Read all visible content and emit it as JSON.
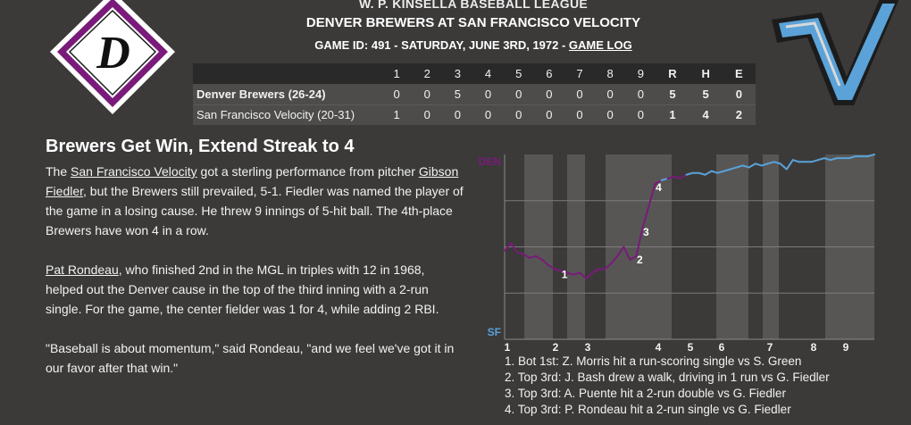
{
  "header": {
    "league": "W. P. KINSELLA BASEBALL LEAGUE",
    "matchup": "DENVER BREWERS AT SAN FRANCISCO VELOCITY",
    "game_info": "GAME ID: 491 - SATURDAY, JUNE 3RD, 1972 - ",
    "game_log_link": "GAME LOG"
  },
  "logos": {
    "home_logo_letter": "D",
    "home_logo_colors": {
      "outer": "#7a1a7a",
      "inner": "#ffffff",
      "letter": "#111111"
    },
    "away_logo_letter": "V",
    "away_logo_colors": {
      "fill": "#5aa2d8",
      "outline": "#1c1c1c"
    }
  },
  "linescore": {
    "innings": [
      "1",
      "2",
      "3",
      "4",
      "5",
      "6",
      "7",
      "8",
      "9"
    ],
    "totals_headers": [
      "R",
      "H",
      "E"
    ],
    "rows": [
      {
        "team": "Denver Brewers (26-24)",
        "innings": [
          "0",
          "0",
          "5",
          "0",
          "0",
          "0",
          "0",
          "0",
          "0"
        ],
        "totals": [
          "5",
          "5",
          "0"
        ]
      },
      {
        "team": "San Francisco Velocity (20-31)",
        "innings": [
          "1",
          "0",
          "0",
          "0",
          "0",
          "0",
          "0",
          "0",
          "0"
        ],
        "totals": [
          "1",
          "4",
          "2"
        ]
      }
    ]
  },
  "article": {
    "headline": "Brewers Get Win, Extend Streak to 4",
    "p1_a": "The ",
    "p1_link1": "San Francisco Velocity",
    "p1_b": " got a sterling performance from pitcher ",
    "p1_link2": "Gibson Fiedler",
    "p1_c": ", but the Brewers still prevailed, 5-1. Fiedler was named the player of the game in a losing cause. He threw 9 innings of 5-hit ball. The 4th-place Brewers have won 4 in a row.",
    "p2_link": "Pat Rondeau",
    "p2_text": ", who finished 2nd in the MGL in triples with 12 in 1968, helped out the Denver cause in the top of the third inning with a 2-run single. For the game, the center fielder was 1 for 4, while adding 2 RBI.",
    "p3": "\"Baseball is about momentum,\" said Rondeau, \"and we feel we've got it in our favor after that win.\""
  },
  "chart_data": {
    "type": "line",
    "top_label": "DEN",
    "bottom_label": "SF",
    "x_labels": [
      "1",
      "2",
      "3",
      "4",
      "5",
      "6",
      "7",
      "8",
      "9"
    ],
    "ylim": [
      0,
      1
    ],
    "colors": {
      "den": "#7a1a7a",
      "sf": "#5aa2d8",
      "label_den": "#7a1a7a",
      "label_sf": "#5aa2d8"
    },
    "series": [
      {
        "values": [
          0.48,
          0.52,
          0.47,
          0.46,
          0.44,
          0.45,
          0.43,
          0.4,
          0.38,
          0.37,
          0.36,
          0.35,
          0.36,
          0.33,
          0.36,
          0.38,
          0.38,
          0.41,
          0.45,
          0.5,
          0.43,
          0.45,
          0.6,
          0.72,
          0.84,
          0.86,
          0.87,
          0.88,
          0.87,
          0.89,
          0.9,
          0.9,
          0.89,
          0.91,
          0.9,
          0.91,
          0.92,
          0.93,
          0.94,
          0.93,
          0.95,
          0.94,
          0.95,
          0.96,
          0.95,
          0.92,
          0.97,
          0.96,
          0.96,
          0.96,
          0.97,
          0.98,
          0.97,
          0.98,
          0.98,
          0.98,
          0.99,
          0.99,
          0.99,
          1.0
        ],
        "marker_points": [
          {
            "label": "1",
            "index": 9
          },
          {
            "label": "2",
            "index": 21
          },
          {
            "label": "3",
            "index": 22
          },
          {
            "label": "4",
            "index": 24
          }
        ]
      }
    ]
  },
  "plays": [
    "1. Bot 1st: Z. Morris hit a run-scoring single vs S. Green",
    "2. Top 3rd: J. Bash drew a walk, driving in 1 run vs G. Fiedler",
    "3. Top 3rd: A. Puente hit a 2-run double vs G. Fiedler",
    "4. Top 3rd: P. Rondeau hit a 2-run single vs G. Fiedler"
  ]
}
